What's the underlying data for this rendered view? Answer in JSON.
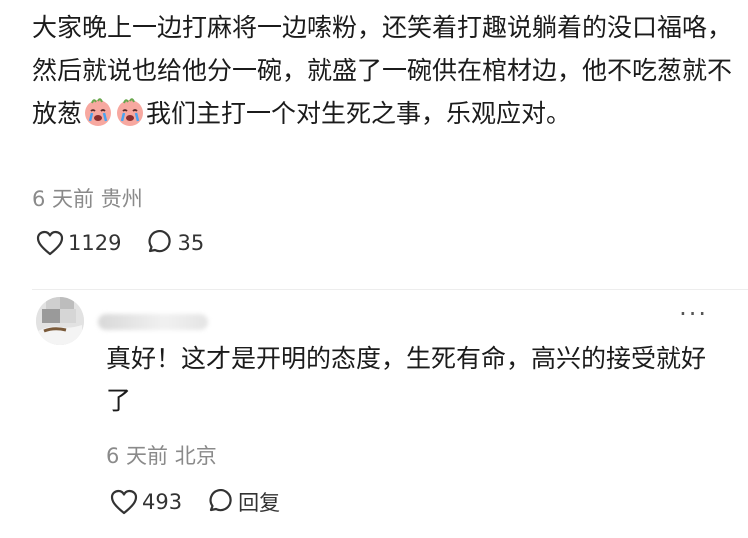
{
  "comment": {
    "text_part1": "大家晚上一边打麻将一边嗦粉，还笑着打趣说躺着的没口福咯，然后就说也给他分一碗，就盛了一碗供在棺材边，他不吃葱就不放葱",
    "text_part2": "我们主打一个对生死之事，乐观应对。",
    "emojis": [
      "crying-face-icon",
      "crying-face-icon"
    ],
    "time": "6 天前",
    "location": "贵州",
    "likes": "1129",
    "replies": "35"
  },
  "reply": {
    "text": "真好！这才是开明的态度，生死有命，高兴的接受就好了",
    "time": "6 天前",
    "location": "北京",
    "likes": "493",
    "reply_label": "回复",
    "more_label": "···"
  }
}
